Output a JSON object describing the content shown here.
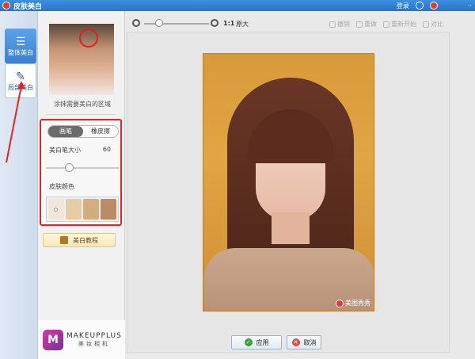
{
  "window": {
    "title": "皮肤美白",
    "right_link": "登录"
  },
  "rail": {
    "whole": "整体美白",
    "local": "局部美白"
  },
  "panel": {
    "caption": "涂抹需要美白的区域",
    "tab_brush": "画笔",
    "tab_eraser": "橡皮擦",
    "size_label": "美白笔大小",
    "size_value": "60",
    "brush_size": 60,
    "skin_label": "皮肤颜色",
    "swatch_colors": [
      "#f2e6d8",
      "#e5cda7",
      "#d4ad7f",
      "#b98b66"
    ],
    "tutorial": "美白教程"
  },
  "ad": {
    "title": "MAKEUPPLUS",
    "subtitle": "美妆相机"
  },
  "toolbar": {
    "one_to_one": "1:1",
    "original": "原大",
    "undo": "撤销",
    "redo": "重做",
    "restart": "重新开始",
    "compare": "对比"
  },
  "photo": {
    "watermark": "美图秀秀"
  },
  "actions": {
    "apply": "应用",
    "cancel": "取消"
  }
}
